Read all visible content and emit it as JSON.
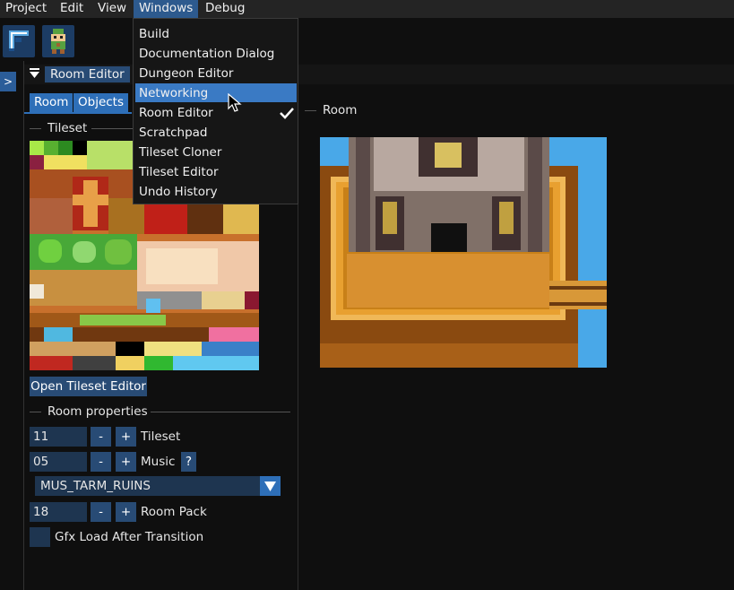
{
  "menubar": {
    "items": [
      "Project",
      "Edit",
      "View",
      "Windows",
      "Debug"
    ],
    "active_index": 3
  },
  "side_toggle": ">",
  "window": {
    "title": "Room Editor"
  },
  "tabs": [
    "Room",
    "Objects"
  ],
  "sections": {
    "tileset": "Tileset",
    "room": "Room",
    "room_properties": "Room properties"
  },
  "open_tileset_editor": "Open Tileset Editor",
  "properties": {
    "tileset": {
      "value": "11",
      "label": "Tileset"
    },
    "music": {
      "value": "05",
      "label": "Music",
      "help": "?"
    },
    "music_select": "MUS_TARM_RUINS",
    "room_pack": {
      "value": "18",
      "label": "Room Pack"
    },
    "gfx_load": {
      "label": "Gfx Load After Transition",
      "checked": false
    },
    "minus": "-",
    "plus": "+"
  },
  "windows_menu": {
    "items": [
      "Build",
      "Documentation Dialog",
      "Dungeon Editor",
      "Networking",
      "Room Editor",
      "Scratchpad",
      "Tileset Cloner",
      "Tileset Editor",
      "Undo History"
    ],
    "highlighted": "Networking",
    "checked": "Room Editor"
  },
  "colors": {
    "accent": "#2e6fb8",
    "highlight": "#3a7ac4",
    "background": "#0f0f0f"
  }
}
